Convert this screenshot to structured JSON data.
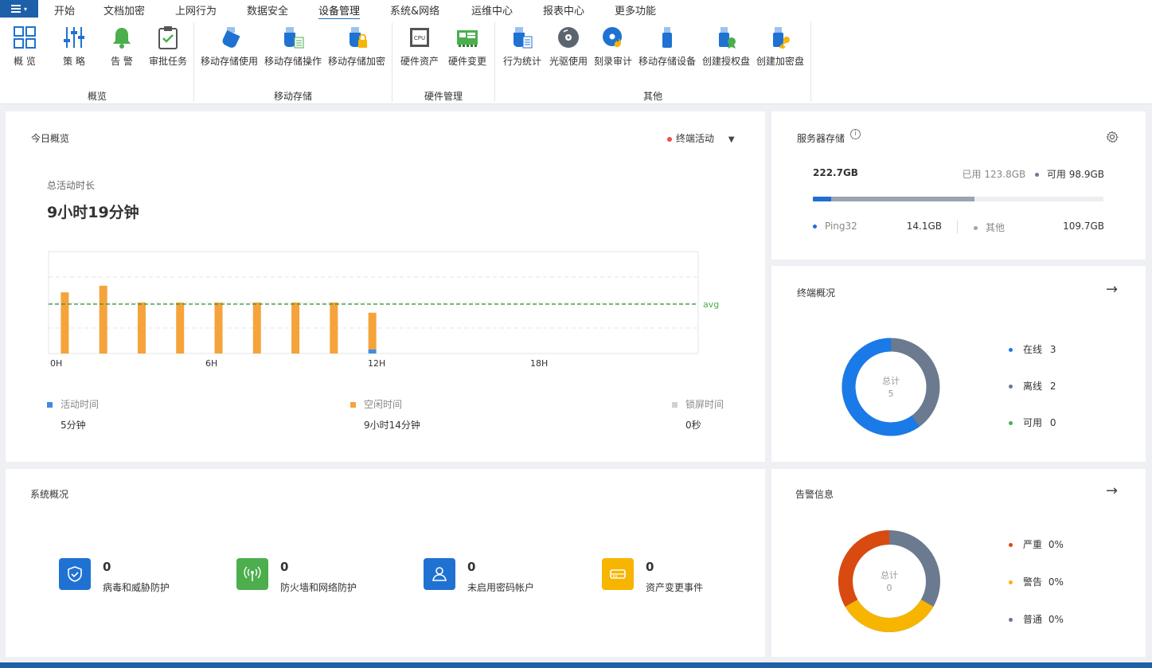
{
  "menu": {
    "tabs": [
      "开始",
      "文档加密",
      "上网行为",
      "数据安全",
      "设备管理",
      "系统&网络",
      "运维中心",
      "报表中心",
      "更多功能"
    ],
    "active": "设备管理"
  },
  "ribbon": {
    "buttons": {
      "overview": "概  览",
      "policy": "策  略",
      "alert": "告  警",
      "approval": "审批任务",
      "usb_use": "移动存储使用",
      "usb_op": "移动存储操作",
      "usb_encrypt": "移动存储加密",
      "hw_asset": "硬件资产",
      "hw_change": "硬件变更",
      "behavior_stats": "行为统计",
      "optical_use": "光驱使用",
      "burn_audit": "刻录审计",
      "usb_device": "移动存储设备",
      "create_auth": "创建授权盘",
      "create_encrypt": "创建加密盘"
    },
    "groups": {
      "overview": "概览",
      "mobile": "移动存储",
      "hardware": "硬件管理",
      "other": "其他"
    }
  },
  "today": {
    "title": "今日概览",
    "filter_label": "终端活动",
    "total_label": "总活动时长",
    "total_value": "9小时19分钟",
    "legend": [
      {
        "label": "活动时间",
        "value": "5分钟",
        "color": "#3d8de0"
      },
      {
        "label": "空闲时间",
        "value": "9小时14分钟",
        "color": "#f5a33a"
      },
      {
        "label": "锁屏时间",
        "value": "0秒",
        "color": "#d0d0d0"
      }
    ]
  },
  "chart_data": {
    "type": "bar",
    "x_ticks": [
      "0H",
      "6H",
      "12H",
      "18H"
    ],
    "x": [
      0,
      1,
      2,
      3,
      4,
      5,
      6,
      7,
      8
    ],
    "series": [
      {
        "name": "活动时间",
        "values": [
          0,
          0,
          0,
          0,
          0,
          0,
          0,
          0,
          0.08
        ]
      },
      {
        "name": "空闲时间",
        "values": [
          1.2,
          1.33,
          1.0,
          1.0,
          1.0,
          1.0,
          1.0,
          1.0,
          0.72
        ]
      }
    ],
    "xlim": [
      0,
      24
    ],
    "ylim": [
      0,
      2
    ],
    "avg": 0.97,
    "avg_label": "avg",
    "grid": true
  },
  "storage": {
    "title": "服务器存储",
    "total": "222.7GB",
    "used_label": "已用",
    "used_value": "123.8GB",
    "free_label": "可用",
    "free_value": "98.9GB",
    "used_fraction": 0.556,
    "ping_fraction": 0.063,
    "items": [
      {
        "name": "Ping32",
        "value": "14.1GB",
        "color": "#1f6fd1"
      },
      {
        "name": "其他",
        "value": "109.7GB",
        "color": "#9aa4b2"
      }
    ]
  },
  "terminals": {
    "title": "终端概况",
    "center_label": "总计",
    "center_value": "5",
    "items": [
      {
        "label": "在线",
        "value": "3",
        "color": "#1a7ae8"
      },
      {
        "label": "离线",
        "value": "2",
        "color": "#6b7a8f"
      },
      {
        "label": "可用",
        "value": "0",
        "color": "#4cae4c"
      }
    ]
  },
  "system": {
    "title": "系统概况",
    "items": [
      {
        "count": "0",
        "label": "病毒和威胁防护",
        "color": "#1f72d2"
      },
      {
        "count": "0",
        "label": "防火墙和网络防护",
        "color": "#4cae4c"
      },
      {
        "count": "0",
        "label": "未启用密码帐户",
        "color": "#1f72d2"
      },
      {
        "count": "0",
        "label": "资产变更事件",
        "color": "#f7b500"
      }
    ]
  },
  "alerts": {
    "title": "告警信息",
    "center_label": "总计",
    "center_value": "0",
    "items": [
      {
        "label": "严重",
        "value": "0%",
        "color": "#d94a10"
      },
      {
        "label": "警告",
        "value": "0%",
        "color": "#f7b500"
      },
      {
        "label": "普通",
        "value": "0%",
        "color": "#6b7a8f"
      }
    ]
  }
}
